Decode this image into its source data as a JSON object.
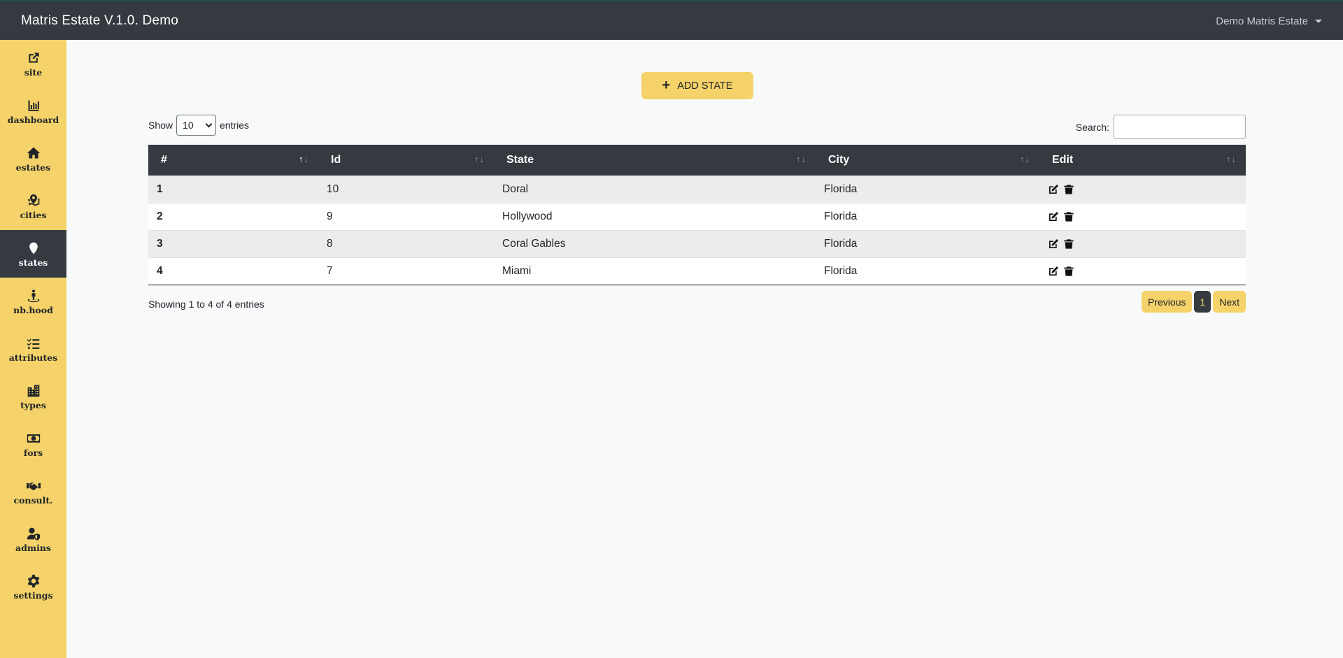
{
  "app": {
    "title": "Matris Estate V.1.0. Demo",
    "user_menu": "Demo Matris Estate"
  },
  "sidebar": {
    "items": [
      {
        "label": "site",
        "icon": "external-link-icon"
      },
      {
        "label": "dashboard",
        "icon": "chart-bar-icon"
      },
      {
        "label": "estates",
        "icon": "home-icon"
      },
      {
        "label": "cities",
        "icon": "map-marked-icon"
      },
      {
        "label": "states",
        "icon": "map-marker-icon",
        "active": true
      },
      {
        "label": "nb.hood",
        "icon": "street-view-icon"
      },
      {
        "label": "attributes",
        "icon": "tasks-list-icon"
      },
      {
        "label": "types",
        "icon": "city-icon"
      },
      {
        "label": "fors",
        "icon": "money-bill-icon"
      },
      {
        "label": "consult.",
        "icon": "handshake-icon"
      },
      {
        "label": "admins",
        "icon": "user-shield-icon"
      },
      {
        "label": "settings",
        "icon": "gear-icon"
      }
    ]
  },
  "toolbar": {
    "add_label": "ADD STATE"
  },
  "table_controls": {
    "show_label": "Show",
    "page_length": "10",
    "entries_label": "entries",
    "search_label": "Search:",
    "search_value": ""
  },
  "table": {
    "columns": [
      "#",
      "Id",
      "State",
      "City",
      "Edit"
    ],
    "rows": [
      {
        "n": "1",
        "id": "10",
        "state": "Doral",
        "city": "Florida"
      },
      {
        "n": "2",
        "id": "9",
        "state": "Hollywood",
        "city": "Florida"
      },
      {
        "n": "3",
        "id": "8",
        "state": "Coral Gables",
        "city": "Florida"
      },
      {
        "n": "4",
        "id": "7",
        "state": "Miami",
        "city": "Florida"
      }
    ]
  },
  "footer": {
    "info": "Showing 1 to 4 of 4 entries",
    "previous": "Previous",
    "page": "1",
    "next": "Next"
  },
  "colors": {
    "accent": "#f5d36a",
    "dark": "#343a40",
    "background": "#f8f9fa"
  }
}
